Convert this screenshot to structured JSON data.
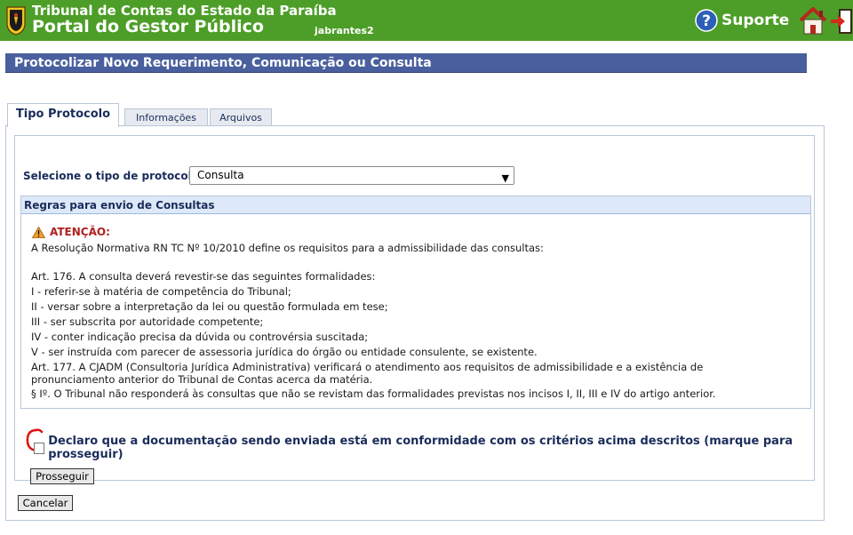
{
  "header": {
    "org_name": "Tribunal de Contas do Estado da Paraíba",
    "portal_name": "Portal do Gestor Público",
    "username": "jabrantes2",
    "support_label": "Suporte",
    "bg_color": "#4d9e28"
  },
  "page": {
    "title": "Protocolizar Novo Requerimento, Comunicação ou Consulta"
  },
  "tabs": [
    {
      "label": "Tipo Protocolo",
      "active": true
    },
    {
      "label": "Informações",
      "active": false
    },
    {
      "label": "Arquivos",
      "active": false
    }
  ],
  "form": {
    "type_label": "Selecione o tipo de protocolo:",
    "type_value": "Consulta"
  },
  "rules": {
    "title": "Regras para envio de Consultas",
    "attention_label": "ATENÇÃO:",
    "lines": [
      "A Resolução Normativa RN TC Nº 10/2010 define os requisitos para a admissibilidade das consultas:",
      "Art. 176. A consulta deverá revestir-se das seguintes formalidades:",
      "I - referir-se à matéria de competência do Tribunal;",
      "II - versar sobre a interpretação da lei ou questão formulada em tese;",
      "III - ser subscrita por autoridade competente;",
      "IV - conter indicação precisa da dúvida ou controvérsia suscitada;",
      "V - ser instruída com parecer de assessoria jurídica do órgão ou entidade consulente, se existente.",
      "Art. 177. A CJADM (Consultoria Jurídica Administrativa) verificará o atendimento aos requisitos de admissibilidade e a existência de pronunciamento anterior do Tribunal de Contas acerca da matéria.",
      "§ Iº. O Tribunal não responderá às consultas que não se revistam das formalidades previstas nos incisos I, II, III e IV do artigo anterior."
    ]
  },
  "declaration": {
    "label": "Declaro que a documentação sendo enviada está em conformidade com os critérios acima descritos (marque para prosseguir)",
    "checked": false
  },
  "buttons": {
    "proceed": "Prosseguir",
    "cancel": "Cancelar"
  },
  "icons": {
    "logo": "tce-crest-icon",
    "support": "help-circle-icon",
    "home": "home-icon",
    "exit": "exit-door-icon",
    "warning": "warning-triangle-icon"
  }
}
